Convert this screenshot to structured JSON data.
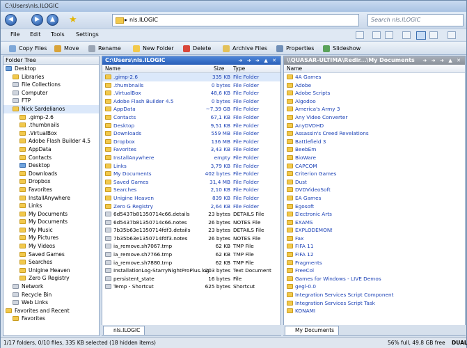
{
  "window": {
    "title": "C:\\Users\\nls.ILOGIC"
  },
  "nav": {
    "address": "nls.ILOGIC",
    "address_arrow": "▸",
    "search_placeholder": "Search nls.ILOGIC"
  },
  "menu": [
    "File",
    "Edit",
    "Tools",
    "Settings"
  ],
  "toolbar": [
    "Copy Files",
    "Move",
    "Rename",
    "New Folder",
    "Delete",
    "Archive Files",
    "Properties",
    "Slideshow"
  ],
  "tree": {
    "header": "Folder Tree",
    "items": [
      {
        "label": "Desktop",
        "indent": 0,
        "icon": "blue"
      },
      {
        "label": "Libraries",
        "indent": 1,
        "icon": "yellow"
      },
      {
        "label": "File Collections",
        "indent": 1,
        "icon": "gray"
      },
      {
        "label": "Computer",
        "indent": 1,
        "icon": "gray"
      },
      {
        "label": "FTP",
        "indent": 1,
        "icon": "gray"
      },
      {
        "label": "Nick Sardelianos",
        "indent": 1,
        "icon": "yellow",
        "selected": true
      },
      {
        "label": ".gimp-2.6",
        "indent": 2,
        "icon": "yellow"
      },
      {
        "label": ".thumbnails",
        "indent": 2,
        "icon": "yellow"
      },
      {
        "label": ".VirtualBox",
        "indent": 2,
        "icon": "yellow"
      },
      {
        "label": "Adobe Flash Builder 4.5",
        "indent": 2,
        "icon": "yellow"
      },
      {
        "label": "AppData",
        "indent": 2,
        "icon": "yellow"
      },
      {
        "label": "Contacts",
        "indent": 2,
        "icon": "yellow"
      },
      {
        "label": "Desktop",
        "indent": 2,
        "icon": "blue"
      },
      {
        "label": "Downloads",
        "indent": 2,
        "icon": "yellow"
      },
      {
        "label": "Dropbox",
        "indent": 2,
        "icon": "yellow"
      },
      {
        "label": "Favorites",
        "indent": 2,
        "icon": "yellow"
      },
      {
        "label": "InstallAnywhere",
        "indent": 2,
        "icon": "yellow"
      },
      {
        "label": "Links",
        "indent": 2,
        "icon": "yellow"
      },
      {
        "label": "My Documents",
        "indent": 2,
        "icon": "yellow"
      },
      {
        "label": "My Documents",
        "indent": 2,
        "icon": "yellow"
      },
      {
        "label": "My Music",
        "indent": 2,
        "icon": "yellow"
      },
      {
        "label": "My Pictures",
        "indent": 2,
        "icon": "yellow"
      },
      {
        "label": "My Videos",
        "indent": 2,
        "icon": "yellow"
      },
      {
        "label": "Saved Games",
        "indent": 2,
        "icon": "yellow"
      },
      {
        "label": "Searches",
        "indent": 2,
        "icon": "yellow"
      },
      {
        "label": "Unigine Heaven",
        "indent": 2,
        "icon": "yellow"
      },
      {
        "label": "Zero G Registry",
        "indent": 2,
        "icon": "yellow"
      },
      {
        "label": "Network",
        "indent": 1,
        "icon": "gray"
      },
      {
        "label": "Recycle Bin",
        "indent": 1,
        "icon": "gray"
      },
      {
        "label": "Web Links",
        "indent": 1,
        "icon": "gray"
      },
      {
        "label": "Favorites and Recent",
        "indent": 0,
        "icon": "yellow"
      },
      {
        "label": "Favorites",
        "indent": 1,
        "icon": "yellow"
      }
    ]
  },
  "left": {
    "header": "C:\\Users\\nls.ILOGIC",
    "arrows": "➜ ➜ ➜ ▲ ✕",
    "cols": [
      "Name",
      "Size",
      "Type"
    ],
    "tab": "nls.ILOGIC",
    "rows": [
      {
        "name": ".gimp-2.6",
        "size": "335 KB",
        "type": "File Folder",
        "folder": true,
        "sel": true
      },
      {
        "name": ".thumbnails",
        "size": "0 bytes",
        "type": "File Folder",
        "folder": true
      },
      {
        "name": ".VirtualBox",
        "size": "48,6 KB",
        "type": "File Folder",
        "folder": true
      },
      {
        "name": "Adobe Flash Builder 4.5",
        "size": "0 bytes",
        "type": "File Folder",
        "folder": true
      },
      {
        "name": "AppData",
        "size": "~7,39 GB",
        "type": "File Folder",
        "folder": true
      },
      {
        "name": "Contacts",
        "size": "67,1 KB",
        "type": "File Folder",
        "folder": true
      },
      {
        "name": "Desktop",
        "size": "9,51 KB",
        "type": "File Folder",
        "folder": true
      },
      {
        "name": "Downloads",
        "size": "559 MB",
        "type": "File Folder",
        "folder": true
      },
      {
        "name": "Dropbox",
        "size": "136 MB",
        "type": "File Folder",
        "folder": true
      },
      {
        "name": "Favorites",
        "size": "3,43 KB",
        "type": "File Folder",
        "folder": true
      },
      {
        "name": "InstallAnywhere",
        "size": "empty",
        "type": "File Folder",
        "folder": true
      },
      {
        "name": "Links",
        "size": "3,79 KB",
        "type": "File Folder",
        "folder": true
      },
      {
        "name": "My Documents",
        "size": "402 bytes",
        "type": "File Folder",
        "folder": true
      },
      {
        "name": "Saved Games",
        "size": "31,4 MB",
        "type": "File Folder",
        "folder": true
      },
      {
        "name": "Searches",
        "size": "2,10 KB",
        "type": "File Folder",
        "folder": true
      },
      {
        "name": "Unigine Heaven",
        "size": "839 KB",
        "type": "File Folder",
        "folder": true
      },
      {
        "name": "Zero G Registry",
        "size": "2,64 KB",
        "type": "File Folder",
        "folder": true
      },
      {
        "name": "6d5437b81350714c66.details",
        "size": "23 bytes",
        "type": "DETAILS File",
        "folder": false
      },
      {
        "name": "6d5437b81350714c66.notes",
        "size": "26 bytes",
        "type": "NOTES File",
        "folder": false
      },
      {
        "name": "7b35b63e1350714fdf3.details",
        "size": "23 bytes",
        "type": "DETAILS File",
        "folder": false
      },
      {
        "name": "7b35b63e1350714fdf3.notes",
        "size": "26 bytes",
        "type": "NOTES File",
        "folder": false
      },
      {
        "name": "ia_remove.sh7067.tmp",
        "size": "62 KB",
        "type": "TMP File",
        "folder": false
      },
      {
        "name": "ia_remove.sh7766.tmp",
        "size": "62 KB",
        "type": "TMP File",
        "folder": false
      },
      {
        "name": "ia_remove.sh7880.tmp",
        "size": "62 KB",
        "type": "TMP File",
        "folder": false
      },
      {
        "name": "InstallationLog-StarryNightProPlus.log",
        "size": "203 bytes",
        "type": "Text Document",
        "folder": false
      },
      {
        "name": "persistent_state",
        "size": "16 bytes",
        "type": "File",
        "folder": false
      },
      {
        "name": "Temp - Shortcut",
        "size": "625 bytes",
        "type": "Shortcut",
        "folder": false
      }
    ]
  },
  "right": {
    "header": "\\\\QUASAR-ULTIMA\\Redir...\\My Documents",
    "arrows": "➜ ➜ ➜ ▲ ✕",
    "cols": [
      "Name"
    ],
    "tab": "My Documents",
    "rows": [
      "4A Games",
      "Adobe",
      "Adobe Scripts",
      "Algodoo",
      "America's Army 3",
      "Any Video Converter",
      "AnyDVDHD",
      "Assassin's Creed Revelations",
      "Battlefield 3",
      "BeebEm",
      "BioWare",
      "CAPCOM",
      "Criterion Games",
      "Dust",
      "DVDVideoSoft",
      "EA Games",
      "Egosoft",
      "Electronic Arts",
      "EXAMS",
      "EXPLODEMON!",
      "Fax",
      "FIFA 11",
      "FIFA 12",
      "Fragments",
      "FreeCol",
      "Games for Windows - LIVE Demos",
      "gegl-0.0",
      "Integration Services Script Component",
      "Integration Services Script Task",
      "KONAMI"
    ]
  },
  "status": {
    "left": "1/17 folders, 0/10 files, 335 KB selected (18 hidden items)",
    "right": "56% full, 49.8 GB free",
    "dual": "DUAL"
  }
}
